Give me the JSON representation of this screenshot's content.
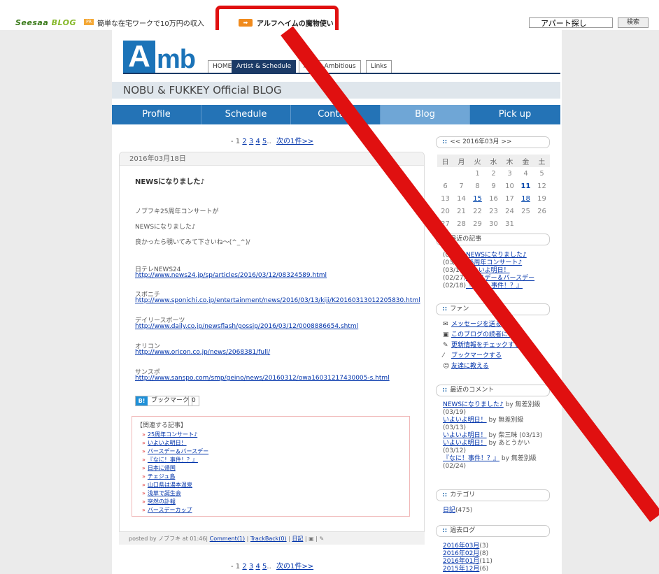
{
  "topbar": {
    "brand_1": "Seesaa",
    "brand_2": "BLOG",
    "pr_badge": "PR",
    "ad_text": "簡単な在宅ワークで10万円の収入",
    "ad2_icon": "➡",
    "ad2_text": "アルフヘイムの魔物使い",
    "search_value": "アパート探し",
    "search_button": "検索"
  },
  "header": {
    "logo_a": "A",
    "logo_mb": "mb",
    "tabs": [
      "HOME",
      "Artist & Schedule",
      "About Ambitious",
      "Links"
    ],
    "band_title": "NOBU & FUKKEY Official BLOG",
    "nav": [
      "Profile",
      "Schedule",
      "Contact",
      "Blog",
      "Pick up"
    ]
  },
  "pager": {
    "dash": "-",
    "pages": [
      "1",
      "2",
      "3",
      "4",
      "5"
    ],
    "ellipsis": "..",
    "next": "次の1件>>"
  },
  "post": {
    "date": "2016年03月18日",
    "title": "NEWSになりました♪",
    "lines": [
      "ノブフキ25周年コンサートが",
      "NEWSになりました♪",
      "良かったら覗いてみて下さいね〜(^_^)/"
    ],
    "sources": [
      {
        "name": "日テレNEWS24",
        "url": "http://www.news24.jp/sp/articles/2016/03/12/08324589.html"
      },
      {
        "name": "スポニチ",
        "url": "http://www.sponichi.co.jp/entertainment/news/2016/03/13/kiji/K20160313012205830.html"
      },
      {
        "name": "デイリースポーツ",
        "url": "http://www.daily.co.jp/newsflash/gossip/2016/03/12/0008886654.shtml"
      },
      {
        "name": "オリコン",
        "url": "http://www.oricon.co.jp/news/2068381/full/"
      },
      {
        "name": "サンスポ",
        "url": "http://www.sanspo.com/smp/geino/news/20160312/owa16031217430005-s.html"
      }
    ],
    "bookmark_icon": "B!",
    "bookmark_label": "ブックマーク",
    "bookmark_count": "0",
    "related_title": "【関連する記事】",
    "related": [
      "25周年コンサート♪",
      "いよいよ明日！",
      "バースデー＆バースデー",
      "『なに！事件！？』",
      "日本に帰国",
      "チェジュ島",
      "山口県は湯本温泉",
      "浅草で誕生会",
      "突然の訃報",
      "バースデーカップ"
    ],
    "footer_prefix": "posted by ノブフキ at 01:46",
    "footer_comment": "Comment(1)",
    "footer_trackback": "TrackBack(0)",
    "footer_category": "日記"
  },
  "sidebar": {
    "calendar_title": "<< 2016年03月 >>",
    "weekdays": [
      "日",
      "月",
      "火",
      "水",
      "木",
      "金",
      "土"
    ],
    "weeks": [
      [
        "",
        "",
        "1",
        "2",
        "3",
        "4",
        "5"
      ],
      [
        "6",
        "7",
        "8",
        "9",
        "10",
        "11",
        "12"
      ],
      [
        "13",
        "14",
        "15",
        "16",
        "17",
        "18",
        "19"
      ],
      [
        "20",
        "21",
        "22",
        "23",
        "24",
        "25",
        "26"
      ],
      [
        "27",
        "28",
        "29",
        "30",
        "31",
        "",
        ""
      ]
    ],
    "recent_title": "最近の記事",
    "recent": [
      {
        "date": "(03/18)",
        "title": "NEWSになりました♪"
      },
      {
        "date": "(03/15)",
        "title": "25周年コンサート♪"
      },
      {
        "date": "(03/11)",
        "title": "いよいよ明日！"
      },
      {
        "date": "(02/27)",
        "title": "バースデー＆バースデー"
      },
      {
        "date": "(02/18)",
        "title": "『なに！事件！？』"
      }
    ],
    "fan_title": "ファン",
    "fan": [
      "メッセージを送る",
      "このブログの読者になる",
      "更新情報をチェックする",
      "ブックマークする",
      "友達に教える"
    ],
    "comments_title": "最近のコメント",
    "comments": [
      {
        "post": "NEWSになりました♪",
        "by": "by 無差別級",
        "date": "(03/19)"
      },
      {
        "post": "いよいよ明日！",
        "by": "by 無差別級",
        "date": "(03/13)"
      },
      {
        "post": "いよいよ明日！",
        "by": "by 柴三昧 (03/13)",
        "date": ""
      },
      {
        "post": "いよいよ明日！",
        "by": "by あとうかい",
        "date": "(03/12)"
      },
      {
        "post": "『なに！事件！？』",
        "by": "by 無差別級",
        "date": "(02/24)"
      }
    ],
    "category_title": "カテゴリ",
    "category": {
      "name": "日記",
      "count": "(475)"
    },
    "archive_title": "過去ログ",
    "archive": [
      {
        "month": "2016年03月",
        "count": "(3)"
      },
      {
        "month": "2016年02月",
        "count": "(8)"
      },
      {
        "month": "2016年01月",
        "count": "(11)"
      },
      {
        "month": "2015年12月",
        "count": "(6)"
      }
    ],
    "bullet": "::"
  },
  "colors": {
    "accent": "#1b73b8",
    "annotation": "#e01010"
  }
}
